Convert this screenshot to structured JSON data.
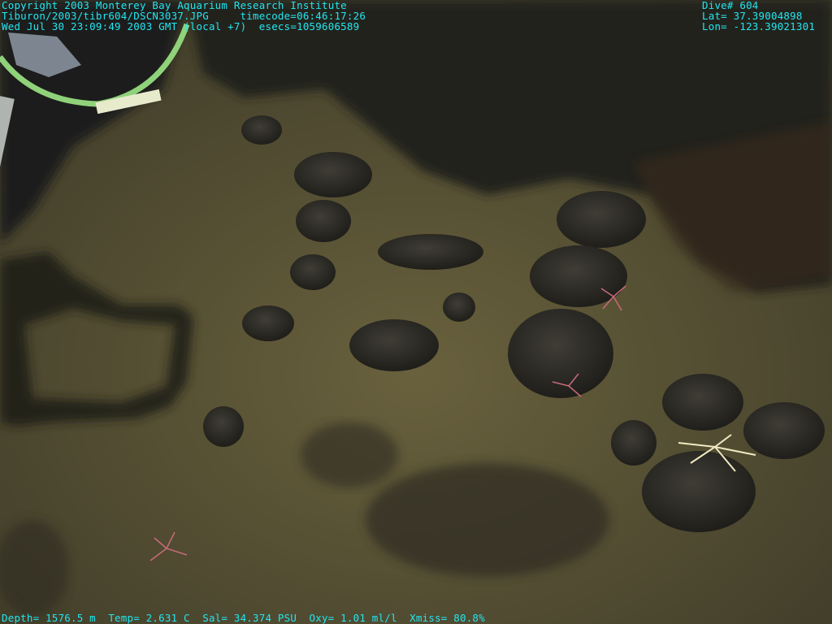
{
  "overlay": {
    "copyright": "Copyright 2003 Monterey Bay Aquarium Research Institute",
    "file_line": "Tiburon/2003/tibr604/DSCN3037.JPG     timecode=06:46:17:26",
    "date_line": "Wed Jul 30 23:09:49 2003 GMT (local +7)  esecs=1059606589",
    "dive": "Dive# 604",
    "lat": "Lat= 37.39004898",
    "lon": "Lon= -123.39021301",
    "sensors": "Depth= 1576.5 m  Temp= 2.631 C  Sal= 34.374 PSU  Oxy= 1.01 ml/l  Xmiss= 80.8%"
  },
  "colors": {
    "overlay_text": "#22e6f0",
    "sediment": "#5b5636",
    "rock": "#2a2a24",
    "cable": "#8fd27a"
  }
}
